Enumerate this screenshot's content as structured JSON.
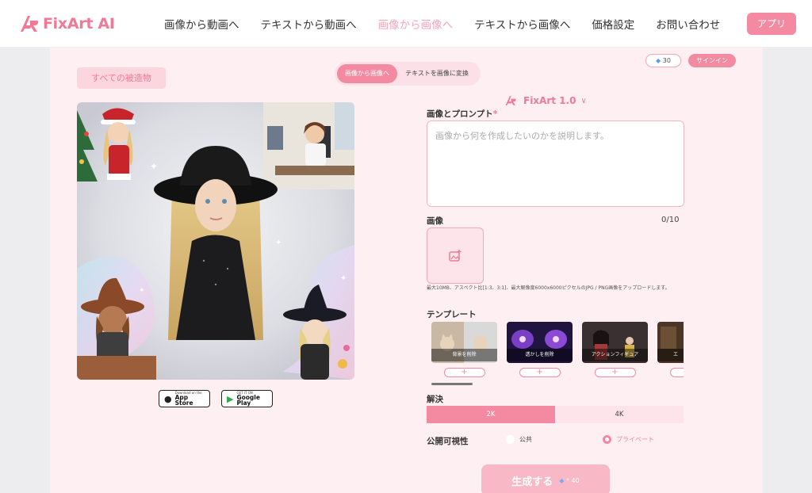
{
  "brand": {
    "logo_text": "FixArt AI",
    "accent": "#f07a95",
    "accent_button": "#f48aa1",
    "panel_bg": "#fdeff2"
  },
  "nav": {
    "items": [
      {
        "label": "画像から動画へ",
        "active": false
      },
      {
        "label": "テキストから動画へ",
        "active": false
      },
      {
        "label": "画像から画像へ",
        "active": true
      },
      {
        "label": "テキストから画像へ",
        "active": false
      },
      {
        "label": "価格設定",
        "active": false
      },
      {
        "label": "お問い合わせ",
        "active": false
      }
    ],
    "app_button": "アプリ"
  },
  "toolbar": {
    "all_creations": "すべての被造物",
    "mode_tabs": [
      "画像から画像へ",
      "テキストを画像に変換"
    ],
    "credits": "30",
    "sign_in": "サインイン"
  },
  "stores": {
    "apple_small": "Download on the",
    "apple_big": "App Store",
    "google_small": "GET IT ON",
    "google_big": "Google Play"
  },
  "form": {
    "model": "FixArt 1.0",
    "prompt_label": "画像とプロンプト",
    "prompt_required_mark": "*",
    "prompt_placeholder": "画像から何を作成したいのかを説明します。",
    "image_label": "画像",
    "image_count": "0/10",
    "upload_note": "最大10MB、アスペクト比[1:3、3:1]、最大解像度6000x6000ピクセルのJPG / PNG画像をアップロードします。",
    "template_label": "テンプレート",
    "templates": [
      {
        "caption": "背景を削除",
        "add": "+"
      },
      {
        "caption": "透かしを削除",
        "add": "+"
      },
      {
        "caption": "アクションフィギュア",
        "add": "+"
      },
      {
        "caption": "エ",
        "add": "+"
      }
    ],
    "resolution_label": "解決",
    "resolutions": [
      {
        "label": "2K",
        "selected": true
      },
      {
        "label": "4K",
        "selected": false
      }
    ],
    "visibility_label": "公開可視性",
    "visibility_options": [
      {
        "label": "公共",
        "selected": false
      },
      {
        "label": "プライベート",
        "selected": true
      }
    ],
    "generate_label": "生成する",
    "generate_cost": "40"
  }
}
